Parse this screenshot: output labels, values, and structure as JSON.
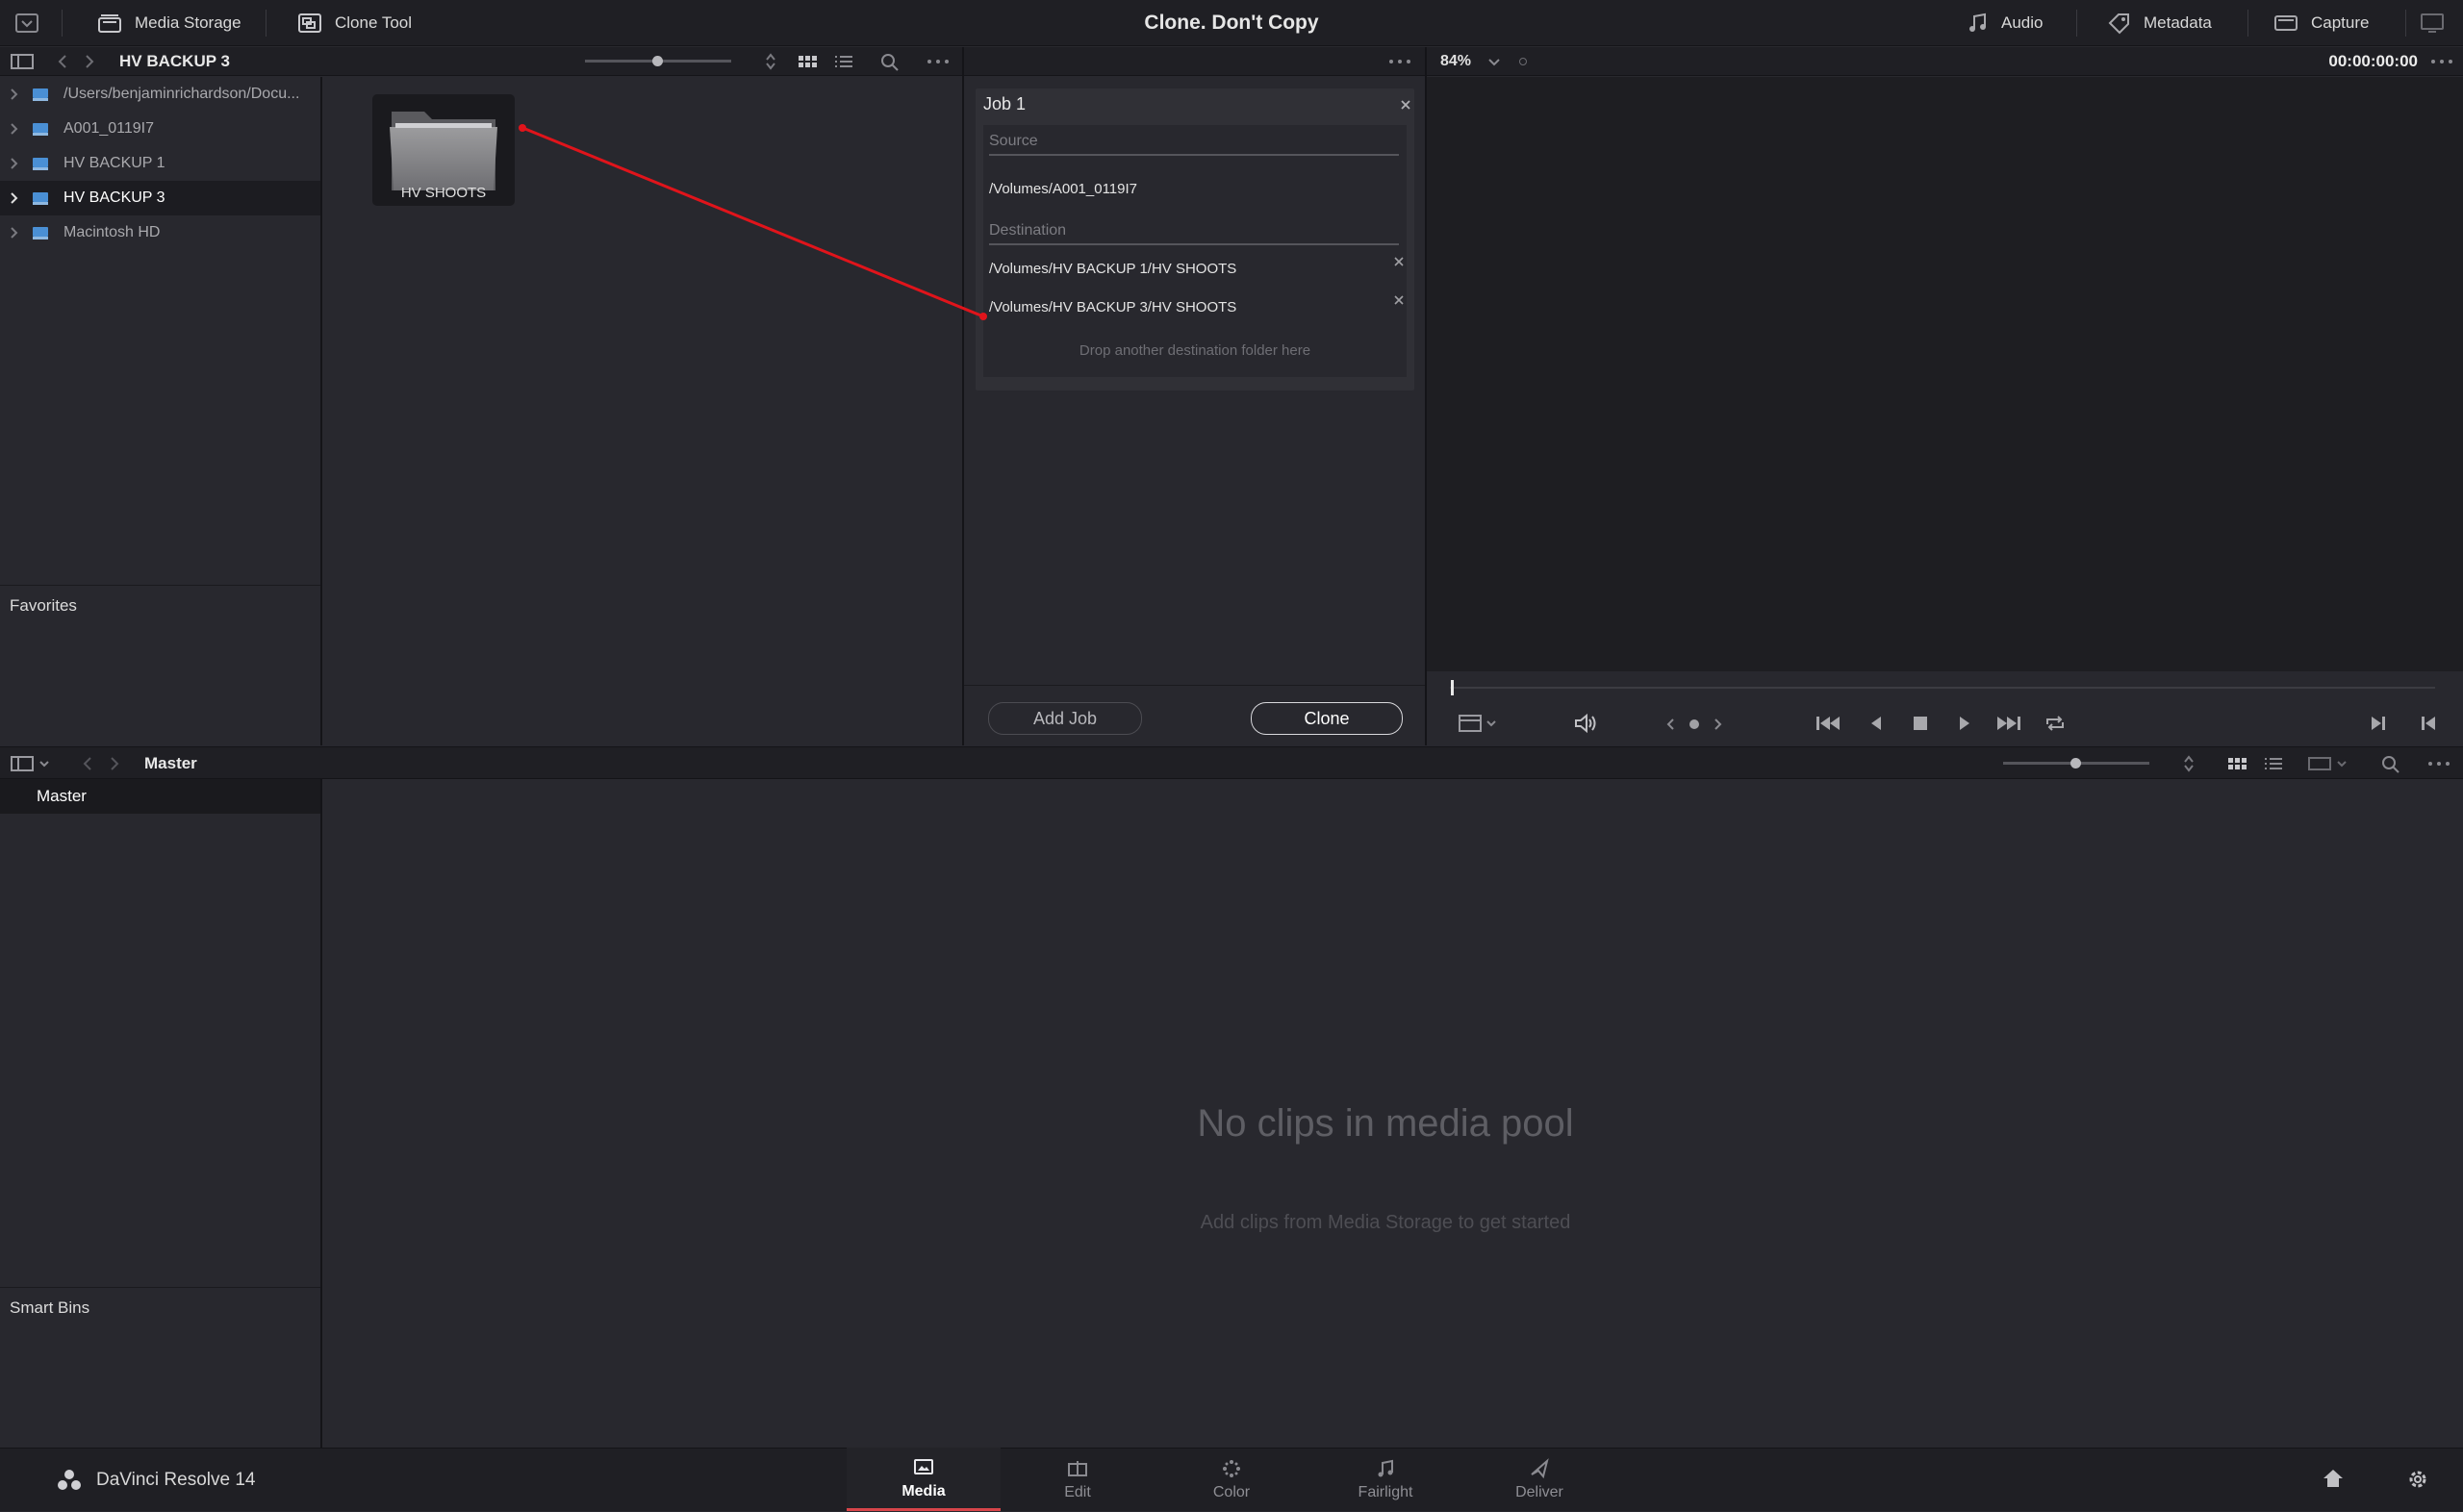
{
  "topbar": {
    "title": "Clone. Don't Copy",
    "media_storage": "Media Storage",
    "clone_tool": "Clone Tool",
    "audio": "Audio",
    "metadata": "Metadata",
    "capture": "Capture"
  },
  "storage": {
    "path_title": "HV BACKUP 3",
    "tree": [
      {
        "label": "/Users/benjaminrichardson/Docu...",
        "selected": false
      },
      {
        "label": "A001_0119I7",
        "selected": false
      },
      {
        "label": "HV BACKUP 1",
        "selected": false
      },
      {
        "label": "HV BACKUP 3",
        "selected": true
      },
      {
        "label": "Macintosh HD",
        "selected": false
      }
    ],
    "favorites": "Favorites",
    "folder_name": "HV SHOOTS"
  },
  "clone": {
    "job_title": "Job 1",
    "source_label": "Source",
    "source_path": "/Volumes/A001_0119I7",
    "destination_label": "Destination",
    "destinations": [
      "/Volumes/HV BACKUP 1/HV SHOOTS",
      "/Volumes/HV BACKUP 3/HV SHOOTS"
    ],
    "drop_hint": "Drop another destination folder here",
    "add_job": "Add Job",
    "clone_button": "Clone"
  },
  "viewer": {
    "zoom": "84%",
    "timecode": "00:00:00:00"
  },
  "pool": {
    "title": "Master",
    "bin_master": "Master",
    "smart_bins": "Smart Bins",
    "empty_title": "No clips in media pool",
    "empty_sub": "Add clips from Media Storage to get started"
  },
  "bottom": {
    "app_name": "DaVinci Resolve 14",
    "tabs": [
      {
        "label": "Media",
        "icon": "media-page-icon",
        "active": true
      },
      {
        "label": "Edit",
        "icon": "edit-page-icon",
        "active": false
      },
      {
        "label": "Color",
        "icon": "color-page-icon",
        "active": false
      },
      {
        "label": "Fairlight",
        "icon": "fairlight-page-icon",
        "active": false
      },
      {
        "label": "Deliver",
        "icon": "deliver-page-icon",
        "active": false
      }
    ]
  },
  "colors": {
    "accent_red": "#d8454a",
    "drive_blue": "#4a8fd4",
    "arrow_red": "#e0141b"
  }
}
